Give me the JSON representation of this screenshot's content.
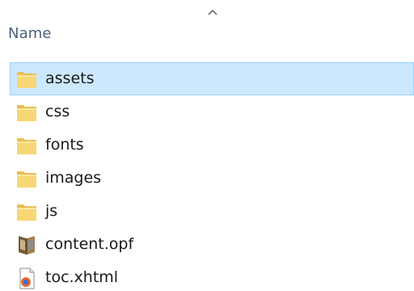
{
  "header": {
    "name_column": "Name",
    "sort_indicator": "ascending"
  },
  "colors": {
    "selection_fill": "#cce8ff",
    "selection_border": "#99d1ff",
    "folder": "#f7d775",
    "header_text": "#4c607a"
  },
  "files": [
    {
      "name": "assets",
      "type": "folder",
      "icon": "folder-icon",
      "selected": true
    },
    {
      "name": "css",
      "type": "folder",
      "icon": "folder-icon",
      "selected": false
    },
    {
      "name": "fonts",
      "type": "folder",
      "icon": "folder-icon",
      "selected": false
    },
    {
      "name": "images",
      "type": "folder",
      "icon": "folder-icon",
      "selected": false
    },
    {
      "name": "js",
      "type": "folder",
      "icon": "folder-icon",
      "selected": false
    },
    {
      "name": "content.opf",
      "type": "file",
      "icon": "opf-file-icon",
      "selected": false
    },
    {
      "name": "toc.xhtml",
      "type": "file",
      "icon": "xhtml-file-icon",
      "selected": false
    }
  ]
}
